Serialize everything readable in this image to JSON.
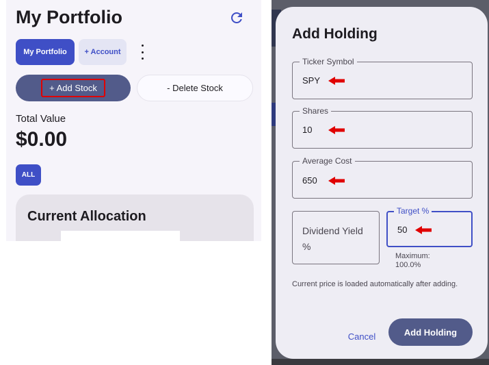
{
  "portfolio_screen": {
    "title": "My Portfolio",
    "refresh_icon": "refresh-icon",
    "tabs": {
      "my_portfolio": "My Portfolio",
      "add_account": "+ Account"
    },
    "more_icon": "more-vert-icon",
    "add_stock": "+ Add Stock",
    "delete_stock": "- Delete Stock",
    "total_value_label": "Total Value",
    "total_value": "$0.00",
    "filter_all": "ALL",
    "allocation_title": "Current Allocation"
  },
  "dialog": {
    "title": "Add Holding",
    "fields": {
      "ticker": {
        "label": "Ticker Symbol",
        "value": "SPY"
      },
      "shares": {
        "label": "Shares",
        "value": "10"
      },
      "average_cost": {
        "label": "Average Cost",
        "value": "650"
      },
      "dividend_yield": {
        "placeholder": "Dividend Yield %"
      },
      "target": {
        "label": "Target %",
        "value": "50",
        "helper": "Maximum: 100.0%"
      }
    },
    "note": "Current price is loaded automatically after adding.",
    "cancel": "Cancel",
    "confirm": "Add Holding"
  },
  "colors": {
    "primary": "#3f4fc6",
    "button_dark": "#525b8a",
    "annotation": "#e00000",
    "scrim": "#5c5e69"
  },
  "icons": {
    "annotation_arrow": "red-arrow-icon"
  }
}
